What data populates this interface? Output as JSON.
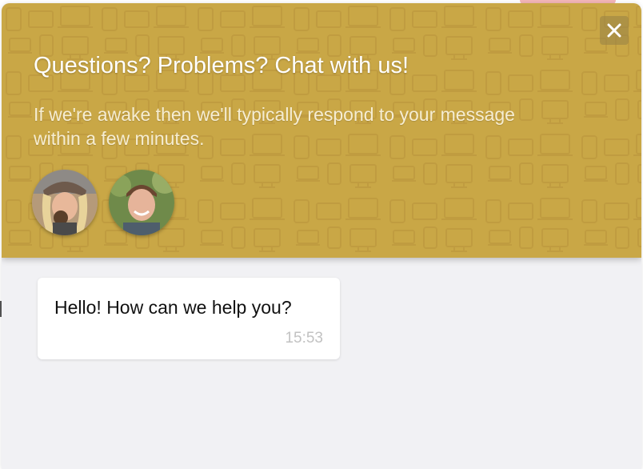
{
  "header": {
    "title": "Questions? Problems? Chat with us!",
    "subtitle": "If we're awake then we'll typically respond to your message within a few minutes.",
    "accent_color": "#c9a746",
    "close_icon": "close-icon"
  },
  "team": {
    "avatars": [
      {
        "name": "avatar-1",
        "desc": "team member photo"
      },
      {
        "name": "avatar-2",
        "desc": "team member photo"
      }
    ]
  },
  "conversation": {
    "messages": [
      {
        "text": "Hello! How can we help you?",
        "time": "15:53"
      }
    ]
  }
}
